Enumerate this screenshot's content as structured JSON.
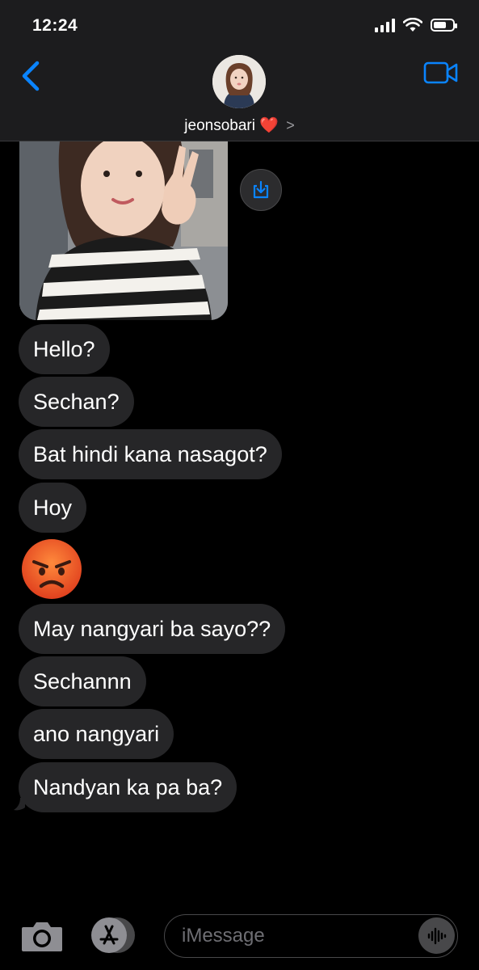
{
  "status_bar": {
    "time": "12:24"
  },
  "header": {
    "contact_name": "jeonsobari",
    "heart": "❤️",
    "chevron": ">",
    "back_icon": "chevron-left-icon",
    "video_icon": "video-camera-icon"
  },
  "messages": [
    "Hello?",
    "Sechan?",
    "Bat hindi kana nasagot?",
    "Hoy",
    "May nangyari ba sayo??",
    "Sechannn",
    "ano nangyari",
    "Nandyan ka pa ba?"
  ],
  "emoji_message": "angry-face-emoji",
  "input": {
    "placeholder": "iMessage"
  },
  "colors": {
    "accent": "#0a84ff",
    "bubble": "#262628",
    "header_bg": "#1c1c1e",
    "background": "#000000"
  }
}
